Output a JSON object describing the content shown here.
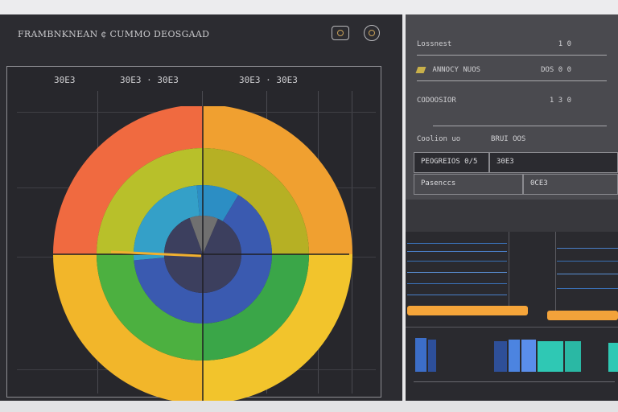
{
  "app": {
    "title": "FRAMBNKNEAN ¢ CUMMO DEOSGAAD"
  },
  "header": {
    "buttons": [
      {
        "icon": "camera-icon"
      },
      {
        "icon": "settings-icon"
      }
    ]
  },
  "chart": {
    "top_labels": [
      "30E3",
      "30E3 · 30E3",
      "30E3 · 30E3"
    ]
  },
  "side": {
    "rows": [
      {
        "label": "Lossnest",
        "value": "1 0"
      },
      {
        "label": "ANNOCY NUOS",
        "value": "DOS 0 0"
      },
      {
        "label": "CODOOSIOR",
        "value": "1 3 0"
      }
    ],
    "table_headers": [
      "Coolion uo",
      "BRUI OOS"
    ],
    "table_rows": [
      {
        "label": "PEOGREIOS 0/5",
        "value": "30E3"
      },
      {
        "label": "Pasenccs",
        "value": "0CE3"
      }
    ]
  },
  "chart_data": {
    "type": "pie",
    "rings": [
      {
        "name": "",
        "values": [
          25,
          25,
          25,
          25
        ],
        "colors": [
          "#f0a030",
          "#f2c42c",
          "#f2b62a",
          "#f06a40"
        ]
      },
      {
        "name": "",
        "values": [
          25,
          25,
          25,
          25
        ],
        "colors": [
          "#b6b024",
          "#3aa648",
          "#4cb040",
          "#b8c02a"
        ]
      },
      {
        "name": "",
        "values": [
          10,
          65,
          25
        ],
        "colors": [
          "#2c8ec4",
          "#3a5ab0",
          "#34a0c8"
        ]
      },
      {
        "name": "",
        "values": [
          12,
          88
        ],
        "colors": [
          "#707070",
          "#3c3f5e"
        ]
      }
    ],
    "title": "",
    "legend": "none"
  },
  "colors": {
    "panel": "#2c2c31",
    "side_panel": "#4a4a4f",
    "accent_orange": "#f6a53a",
    "accent_blue": "#3c7ed4",
    "accent_teal": "#2fc8b4"
  }
}
